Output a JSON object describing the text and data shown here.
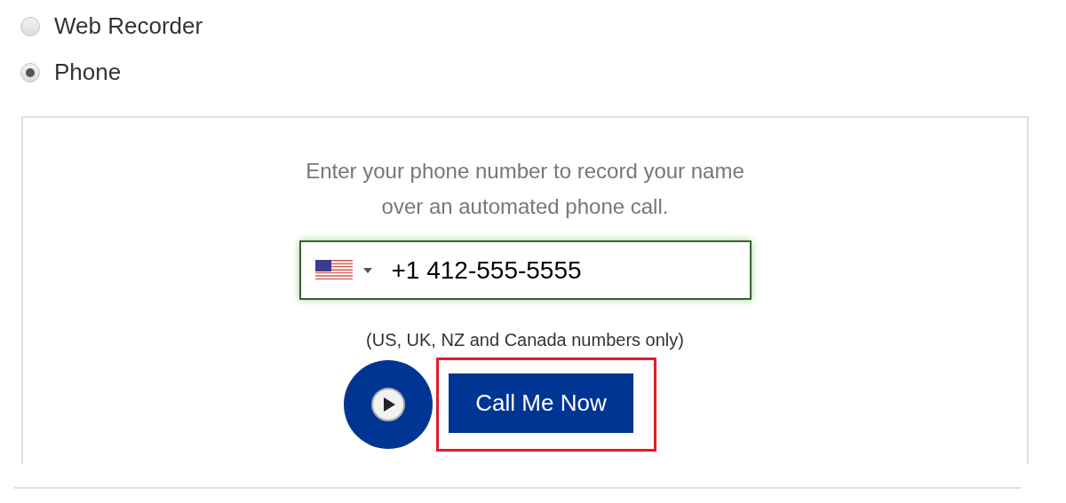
{
  "recording_options": [
    {
      "label": "Web Recorder",
      "selected": false
    },
    {
      "label": "Phone",
      "selected": true
    }
  ],
  "phone_panel": {
    "instructions": "Enter your phone number to record your name over an automated phone call.",
    "phone_field": {
      "value": "+1 412-555-5555",
      "focused": true
    },
    "note": "(US, UK, NZ and Canada numbers only)",
    "call_button": {
      "label": "Call Me Now",
      "highlighted": true
    }
  }
}
